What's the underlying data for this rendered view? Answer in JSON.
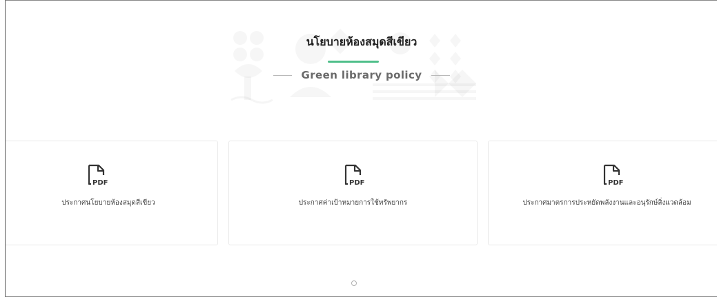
{
  "section": {
    "title_th": "นโยบายห้องสมุดสีเขียว",
    "subtitle_en": "Green library policy",
    "accent_color": "#4fbf8a"
  },
  "documents": [
    {
      "icon": "pdf-file-icon",
      "icon_text": "PDF",
      "label": "ประกาศนโยบายห้องสมุดสีเขียว"
    },
    {
      "icon": "pdf-file-icon",
      "icon_text": "PDF",
      "label": "ประกาศค่าเป้าหมายการใช้ทรัพยากร"
    },
    {
      "icon": "pdf-file-icon",
      "icon_text": "PDF",
      "label": "ประกาศมาตรการประหยัดพลังงานและอนุรักษ์สิ่งแวดล้อม"
    }
  ],
  "pagination": {
    "pages": 1,
    "current": 1
  }
}
